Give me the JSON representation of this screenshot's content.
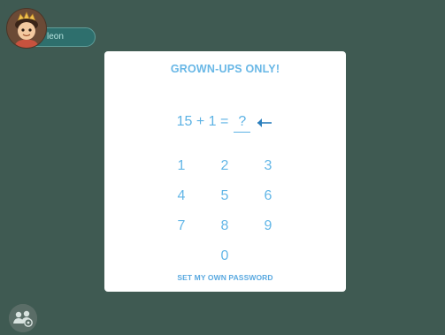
{
  "user": {
    "name": "leon",
    "avatar_icon": "child-avatar-icon"
  },
  "dialog": {
    "title": "GROWN-UPS ONLY!",
    "question": "15 + 1 =",
    "answer_placeholder": "?",
    "keys": [
      "1",
      "2",
      "3",
      "4",
      "5",
      "6",
      "7",
      "8",
      "9",
      "0"
    ],
    "set_password_label": "SET MY OWN PASSWORD"
  },
  "colors": {
    "background": "#3f5a52",
    "dialog": "#ffffff",
    "accent": "#64b7e7",
    "user_chip": "#2e6f6d"
  },
  "bottom_button_icon": "profiles-icon"
}
